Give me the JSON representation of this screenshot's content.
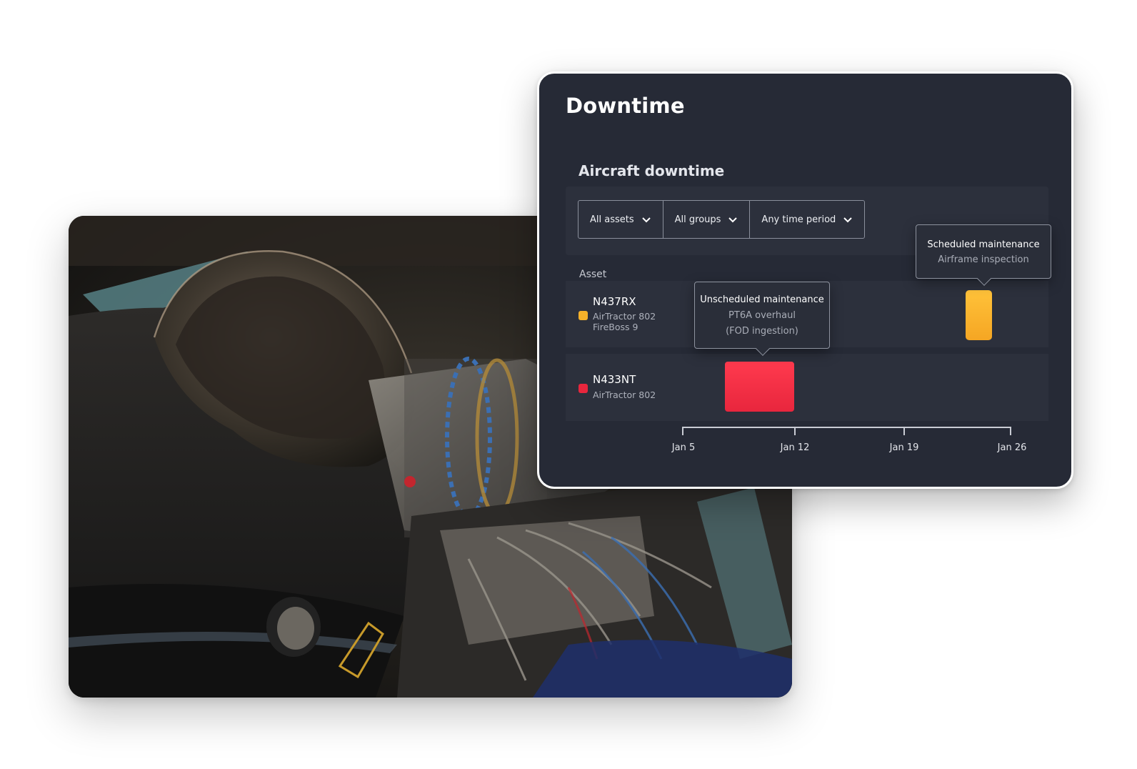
{
  "dashboard": {
    "title": "Downtime",
    "section_title": "Aircraft downtime",
    "filters": [
      {
        "label": "All assets"
      },
      {
        "label": "All groups"
      },
      {
        "label": "Any time period"
      }
    ],
    "column_label": "Asset",
    "rows": [
      {
        "name": "N437RX",
        "model": "AirTractor 802",
        "variant": "FireBoss 9",
        "status_color": "#f5b12a"
      },
      {
        "name": "N433NT",
        "model": "AirTractor 802",
        "status_color": "#e8263d"
      }
    ],
    "tooltips": {
      "unscheduled": {
        "title": "Unscheduled maintenance",
        "line1": "PT6A overhaul",
        "line2": "(FOD ingestion)"
      },
      "scheduled": {
        "title": "Scheduled maintenance",
        "line1": "Airframe inspection"
      }
    },
    "axis": {
      "ticks": [
        "Jan 5",
        "Jan 12",
        "Jan 19",
        "Jan 26"
      ]
    },
    "colors": {
      "card_bg": "#262a36",
      "row_bg": "#2c303c",
      "unscheduled": "#e8263d",
      "scheduled": "#f5a623"
    }
  },
  "photo": {
    "subject": "turboprop-engine"
  }
}
